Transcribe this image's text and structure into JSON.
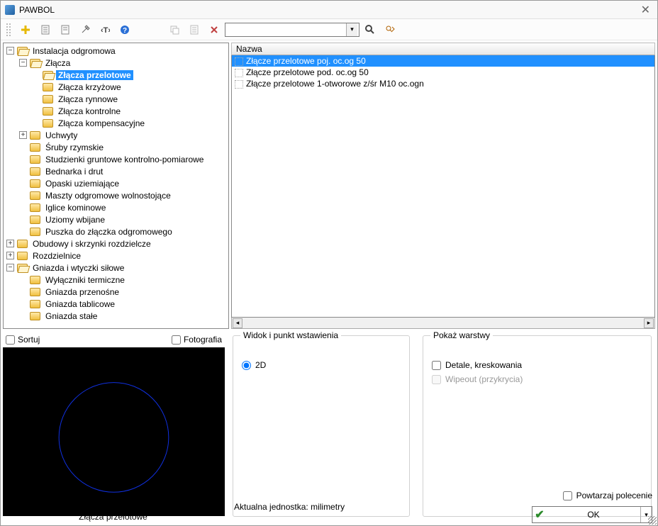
{
  "window": {
    "title": "PAWBOL"
  },
  "toolbar": {
    "icons": [
      "plus",
      "page",
      "page2",
      "tools",
      "text",
      "help",
      "",
      "copy",
      "props",
      "delete"
    ],
    "search_value": ""
  },
  "tree": [
    {
      "depth": 0,
      "twisty": "-",
      "open": true,
      "label": "Instalacja odgromowa"
    },
    {
      "depth": 1,
      "twisty": "-",
      "open": true,
      "label": "Złącza"
    },
    {
      "depth": 2,
      "twisty": "",
      "open": true,
      "label": "Złącza przelotowe",
      "selected": true
    },
    {
      "depth": 2,
      "twisty": "",
      "open": false,
      "label": "Złącza krzyżowe"
    },
    {
      "depth": 2,
      "twisty": "",
      "open": false,
      "label": "Złącza rynnowe"
    },
    {
      "depth": 2,
      "twisty": "",
      "open": false,
      "label": "Złącza kontrolne"
    },
    {
      "depth": 2,
      "twisty": "",
      "open": false,
      "label": "Złącza kompensacyjne"
    },
    {
      "depth": 1,
      "twisty": "+",
      "open": false,
      "label": "Uchwyty"
    },
    {
      "depth": 1,
      "twisty": "",
      "open": false,
      "label": "Śruby rzymskie"
    },
    {
      "depth": 1,
      "twisty": "",
      "open": false,
      "label": "Studzienki gruntowe kontrolno-pomiarowe"
    },
    {
      "depth": 1,
      "twisty": "",
      "open": false,
      "label": "Bednarka i drut"
    },
    {
      "depth": 1,
      "twisty": "",
      "open": false,
      "label": "Opaski uziemiające"
    },
    {
      "depth": 1,
      "twisty": "",
      "open": false,
      "label": "Maszty odgromowe wolnostojące"
    },
    {
      "depth": 1,
      "twisty": "",
      "open": false,
      "label": "Iglice kominowe"
    },
    {
      "depth": 1,
      "twisty": "",
      "open": false,
      "label": "Uziomy wbijane"
    },
    {
      "depth": 1,
      "twisty": "",
      "open": false,
      "label": "Puszka do złączka odgromowego"
    },
    {
      "depth": 0,
      "twisty": "+",
      "open": false,
      "label": "Obudowy i skrzynki rozdzielcze"
    },
    {
      "depth": 0,
      "twisty": "+",
      "open": false,
      "label": "Rozdzielnice"
    },
    {
      "depth": 0,
      "twisty": "-",
      "open": true,
      "label": "Gniazda i wtyczki siłowe"
    },
    {
      "depth": 1,
      "twisty": "",
      "open": false,
      "label": "Wyłączniki termiczne"
    },
    {
      "depth": 1,
      "twisty": "",
      "open": false,
      "label": "Gniazda przenośne"
    },
    {
      "depth": 1,
      "twisty": "",
      "open": false,
      "label": "Gniazda tablicowe"
    },
    {
      "depth": 1,
      "twisty": "",
      "open": false,
      "label": "Gniazda stałe"
    }
  ],
  "list": {
    "header": "Nazwa",
    "rows": [
      {
        "label": "Złącze przelotowe poj. oc.og 50",
        "selected": true
      },
      {
        "label": "Złącze przelotowe pod. oc.og 50",
        "selected": false
      },
      {
        "label": "Złącze przelotowe 1-otworowe z/śr M10 oc.ogn",
        "selected": false
      }
    ]
  },
  "preview": {
    "sort_label": "Sortuj",
    "photo_label": "Fotografia",
    "caption": "Złącza przelotowe"
  },
  "options": {
    "grp1_title": "Widok i punkt wstawienia",
    "radio_2d": "2D",
    "grp2_title": "Pokaż warstwy",
    "chk_details": "Detale, kreskowania",
    "chk_wipeout": "Wipeout (przykrycia)"
  },
  "bottom": {
    "unit_text": "Aktualna jednostka: milimetry",
    "repeat_label": "Powtarzaj polecenie",
    "ok_label": "OK"
  }
}
